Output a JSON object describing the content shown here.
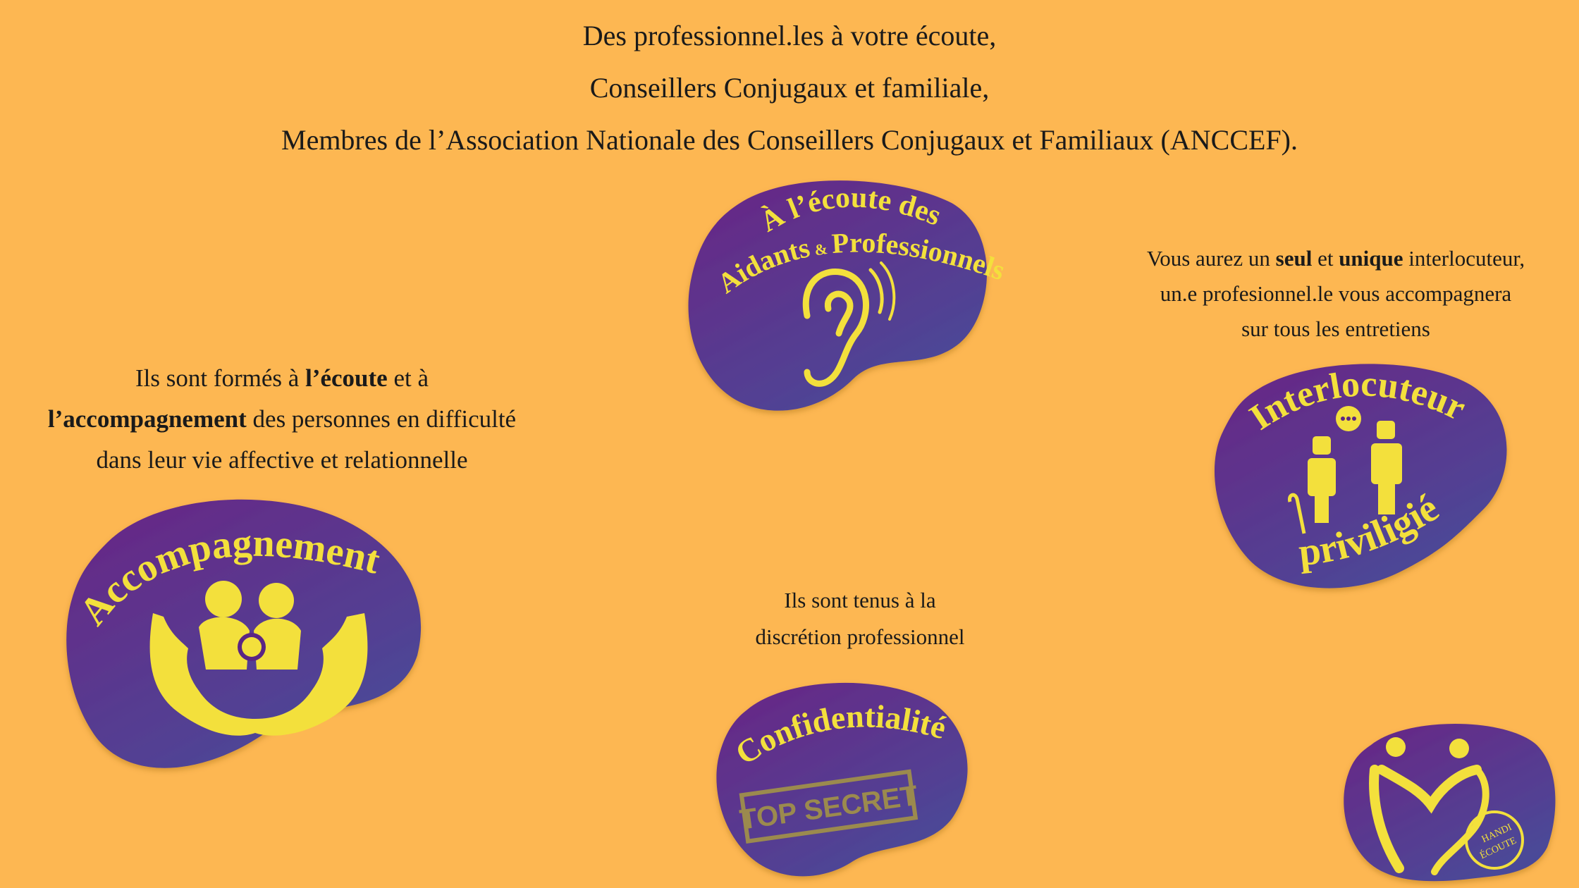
{
  "header": {
    "line1": "Des professionnel.les à votre écoute,",
    "line2": "Conseillers Conjugaux et familiale,",
    "line3": "Membres de l’Association Nationale des Conseillers Conjugaux et Familiaux (ANCCEF)."
  },
  "left_block": {
    "l1_pre": "Ils sont formés à ",
    "l1_bold": "l’écoute",
    "l1_post": " et à",
    "l2_bold": "l’accompagnement",
    "l2_post": " des personnes en difficulté",
    "l3": "dans leur vie affective et relationnelle"
  },
  "right_block": {
    "l1_pre": "Vous aurez un ",
    "l1_bold1": "seul",
    "l1_mid": " et ",
    "l1_bold2": "unique",
    "l1_post": " interlocuteur,",
    "l2": "un.e profesionnel.le vous accompagnera",
    "l3": "sur tous les entretiens"
  },
  "mid_block": {
    "l1": "Ils sont tenus à la",
    "l2": "discrétion professionnel"
  },
  "badges": {
    "ecoute": {
      "line1": "À l’écoute des",
      "line2_a": "Aidants",
      "line2_amp": "&",
      "line2_b": "Professionnels",
      "icon": "ear-icon"
    },
    "interlocuteur": {
      "line1": "Interlocuteur",
      "line2": "priviligié",
      "icon": "two-people-icon"
    },
    "accompagnement": {
      "label": "Accompagnement",
      "icon": "family-in-hands-icon"
    },
    "confidentialite": {
      "label": "Confidentialité",
      "stamp": "TOP SECRET",
      "icon": "stamp-icon"
    },
    "handi": {
      "line1": "HANDI",
      "line2": "ÉCOUTE",
      "icon": "handi-heart-icon"
    }
  },
  "colors": {
    "background": "#FDB752",
    "badge_purple_dark": "#5B2584",
    "badge_purple_light": "#4B4A9A",
    "badge_yellow": "#F3E03C"
  }
}
